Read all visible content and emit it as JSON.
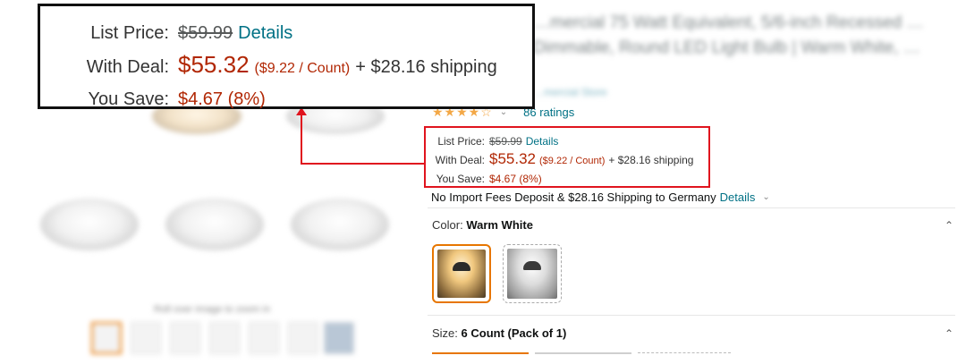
{
  "background": {
    "product_title": "…mercial 75 Watt Equivalent, 5/6-inch Recessed … Dimmable, Round LED Light Bulb | Warm White, …",
    "store_link": "…mercial Store",
    "image_caption": "Roll over image to zoom in"
  },
  "rating": {
    "stars": "★★★★☆",
    "chevron_icon": "chevron-down-icon",
    "ratings_text": "86 ratings"
  },
  "price": {
    "list_price_label": "List Price:",
    "list_price": "$59.99",
    "details_link": "Details",
    "with_deal_label": "With Deal:",
    "deal_price": "$55.32",
    "unit_price": "($9.22 / Count)",
    "shipping": "+ $28.16 shipping",
    "you_save_label": "You Save:",
    "you_save": "$4.67 (8%)"
  },
  "import_fees": {
    "text": "No Import Fees Deposit & $28.16 Shipping to Germany",
    "details_link": "Details",
    "chevron_icon": "chevron-down-icon"
  },
  "color": {
    "label": "Color:",
    "value": "Warm White",
    "collapse_icon": "chevron-up-icon",
    "swatches": [
      "Warm White",
      "Cool White"
    ]
  },
  "size": {
    "label": "Size:",
    "value": "6 Count (Pack of 1)",
    "collapse_icon": "chevron-up-icon"
  },
  "annotation": {
    "highlight_color": "#e0141e",
    "zoom_border_color": "#111111"
  }
}
